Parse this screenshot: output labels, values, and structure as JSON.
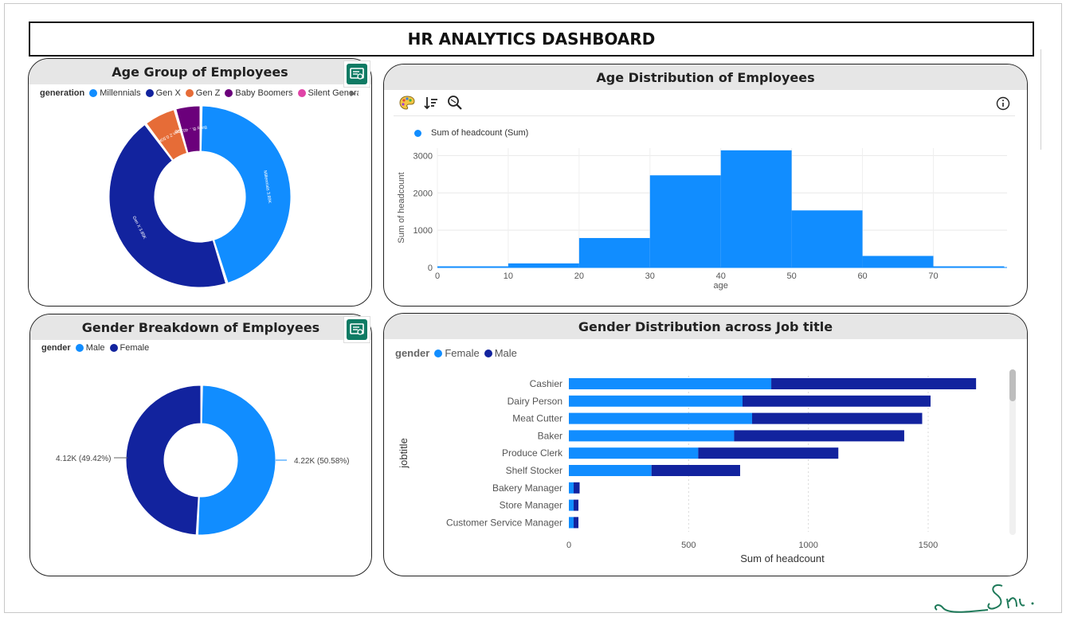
{
  "dashboard": {
    "title": "HR ANALYTICS DASHBOARD"
  },
  "age_group_card": {
    "title": "Age Group of Employees",
    "legend_title": "generation",
    "legend": [
      {
        "label": "Millennials",
        "color": "#118dff"
      },
      {
        "label": "Gen X",
        "color": "#12239e"
      },
      {
        "label": "Gen Z",
        "color": "#e66c37"
      },
      {
        "label": "Baby Boomers",
        "color": "#6b007b"
      },
      {
        "label": "Silent Generatio",
        "color": "#e044a7"
      }
    ],
    "legend_more_icon": "chevron-right-icon",
    "slice_labels": {
      "millennials": "Millennials 3.89K",
      "genx": "Gen X 3.85K",
      "genz": "Gen Z 0.50K",
      "boomers": "Baby B... 401.00"
    }
  },
  "age_dist_card": {
    "title": "Age Distribution of Employees",
    "legend_label": "Sum of headcount (Sum)",
    "ylabel": "Sum of headcount",
    "xlabel": "age",
    "toolbar_icons": [
      "palette-icon",
      "sort-icon",
      "zoom-icon"
    ],
    "info_icon": "info-icon"
  },
  "gender_card": {
    "title": "Gender Breakdown of Employees",
    "legend_title": "gender",
    "legend": [
      {
        "label": "Male",
        "color": "#118dff"
      },
      {
        "label": "Female",
        "color": "#12239e"
      }
    ],
    "label_left": "4.12K (49.42%)",
    "label_right": "4.22K (50.58%)"
  },
  "job_card": {
    "title": "Gender Distribution across Job title",
    "legend_title": "gender",
    "legend": [
      {
        "label": "Female",
        "color": "#118dff"
      },
      {
        "label": "Male",
        "color": "#12239e"
      }
    ],
    "ylabel": "jobtitle",
    "xlabel": "Sum of headcount"
  },
  "signature": "Sn.",
  "chart_data": [
    {
      "type": "pie",
      "title": "Age Group of Employees",
      "categories": [
        "Millennials",
        "Gen X",
        "Gen Z",
        "Baby Boomers"
      ],
      "values": [
        3890,
        3850,
        500,
        401
      ],
      "colors": [
        "#118dff",
        "#12239e",
        "#e66c37",
        "#6b007b"
      ]
    },
    {
      "type": "bar",
      "title": "Age Distribution of Employees",
      "x_bins": [
        [
          0,
          10
        ],
        [
          10,
          20
        ],
        [
          20,
          30
        ],
        [
          30,
          40
        ],
        [
          40,
          50
        ],
        [
          50,
          60
        ],
        [
          60,
          70
        ],
        [
          70,
          80
        ]
      ],
      "values": [
        0,
        110,
        790,
        2470,
        3140,
        1530,
        310,
        0
      ],
      "xlim": [
        0,
        80
      ],
      "ylim": [
        0,
        3200
      ],
      "xticks": [
        0,
        10,
        20,
        30,
        40,
        50,
        60,
        70
      ],
      "yticks": [
        0,
        1000,
        2000,
        3000
      ],
      "xlabel": "age",
      "ylabel": "Sum of headcount",
      "color": "#118dff",
      "grid": true
    },
    {
      "type": "pie",
      "title": "Gender Breakdown of Employees",
      "categories": [
        "Male",
        "Female"
      ],
      "values": [
        4220,
        4120
      ],
      "colors": [
        "#118dff",
        "#12239e"
      ]
    },
    {
      "type": "bar",
      "orientation": "horizontal",
      "stacked": true,
      "title": "Gender Distribution across Job title",
      "categories": [
        "Cashier",
        "Dairy Person",
        "Meat Cutter",
        "Baker",
        "Produce Clerk",
        "Shelf Stocker",
        "Bakery Manager",
        "Store Manager",
        "Customer Service Manager"
      ],
      "series": [
        {
          "name": "Female",
          "values": [
            845,
            725,
            765,
            690,
            540,
            345,
            20,
            20,
            20
          ],
          "color": "#118dff"
        },
        {
          "name": "Male",
          "values": [
            855,
            785,
            710,
            710,
            585,
            370,
            25,
            20,
            20
          ],
          "color": "#12239e"
        }
      ],
      "xlim": [
        0,
        1800
      ],
      "xticks": [
        0,
        500,
        1000,
        1500
      ],
      "xlabel": "Sum of headcount",
      "ylabel": "jobtitle",
      "grid": true
    }
  ]
}
